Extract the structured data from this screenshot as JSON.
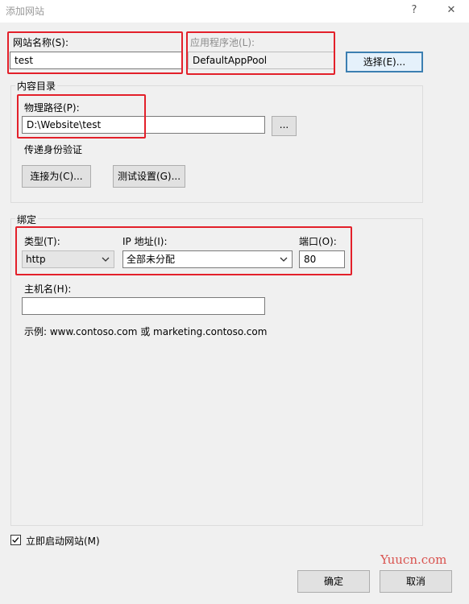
{
  "window": {
    "title": "添加网站",
    "help_glyph": "?",
    "close_glyph": "✕"
  },
  "site_name": {
    "label": "网站名称(S):",
    "value": "test"
  },
  "app_pool": {
    "label": "应用程序池(L):",
    "value": "DefaultAppPool",
    "select_button": "选择(E)..."
  },
  "content": {
    "group_title": "内容目录",
    "physical_path_label": "物理路径(P):",
    "physical_path_value": "D:\\Website\\test",
    "browse_button": "...",
    "passthrough_label": "传递身份验证",
    "connect_as_button": "连接为(C)...",
    "test_settings_button": "测试设置(G)..."
  },
  "binding": {
    "group_title": "绑定",
    "type_label": "类型(T):",
    "type_value": "http",
    "ip_label": "IP 地址(I):",
    "ip_value": "全部未分配",
    "port_label": "端口(O):",
    "port_value": "80",
    "hostname_label": "主机名(H):",
    "hostname_value": "",
    "example_text": "示例: www.contoso.com 或 marketing.contoso.com"
  },
  "start_immediately": {
    "label": "立即启动网站(M)",
    "checked": true,
    "check_glyph": "✓"
  },
  "footer": {
    "ok_button": "确定",
    "cancel_button": "取消"
  },
  "watermark": "Yuucn.com",
  "colors": {
    "highlight_box": "#e3202a",
    "watermark": "#d9534f",
    "default_button_border": "#3c7fb1"
  }
}
